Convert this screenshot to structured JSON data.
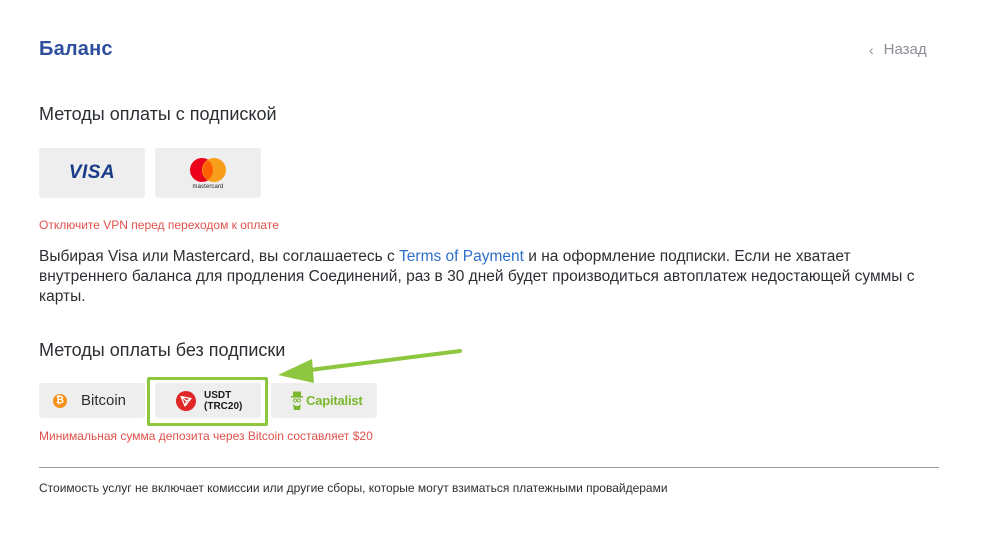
{
  "header": {
    "title": "Баланс",
    "back_label": "Назад"
  },
  "subscription": {
    "title": "Методы оплаты с подпиской",
    "methods": [
      {
        "name": "VISA"
      },
      {
        "name": "mastercard"
      }
    ],
    "vpn_warning": "Отключите VPN перед переходом к оплате",
    "agreement_before": "Выбирая Visa или Mastercard, вы соглашаетесь с ",
    "agreement_link": "Terms of Payment",
    "agreement_after": " и на оформление подписки. Если не хватает внутреннего баланса для продления Соединений, раз в 30 дней будет производиться автоплатеж недостающей суммы с карты."
  },
  "no_subscription": {
    "title": "Методы оплаты без подписки",
    "methods": [
      {
        "name": "Bitcoin",
        "icon": "bitcoin-icon"
      },
      {
        "name_line1": "USDT",
        "name_line2": "(TRC20)",
        "icon": "tron-icon"
      },
      {
        "name": "Capitalist",
        "icon": "capitalist-icon"
      }
    ],
    "min_deposit_note": "Минимальная сумма депозита через Bitcoin составляет $20"
  },
  "footer": {
    "note": "Стоимость услуг не включает комиссии или другие сборы, которые могут взиматься платежными провайдерами"
  },
  "colors": {
    "title_blue": "#2d4f9e",
    "link_blue": "#2d6fc9",
    "warning_red": "#e0504a",
    "highlight_green": "#8dc63f",
    "card_bg": "#eeeeee",
    "bitcoin_orange": "#f7931a",
    "tron_red": "#e02626"
  }
}
